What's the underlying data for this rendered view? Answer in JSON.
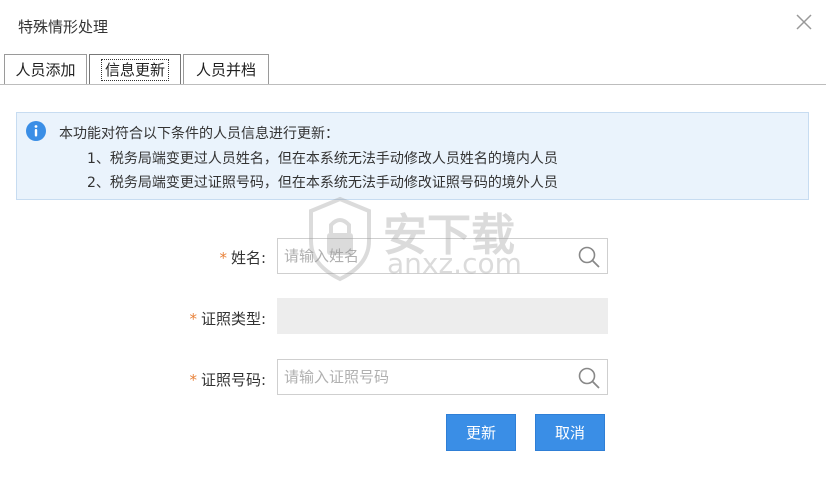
{
  "dialog": {
    "title": "特殊情形处理",
    "close_icon": "close-icon"
  },
  "tabs": [
    {
      "label": "人员添加",
      "active": false
    },
    {
      "label": "信息更新",
      "active": true
    },
    {
      "label": "人员并档",
      "active": false
    }
  ],
  "notice": {
    "icon": "info-icon",
    "line1": "本功能对符合以下条件的人员信息进行更新：",
    "line2": "1、税务局端变更过人员姓名，但在本系统无法手动修改人员姓名的境内人员",
    "line3": "2、税务局端变更过证照号码，但在本系统无法手动修改证照号码的境外人员"
  },
  "form": {
    "required_mark": "*",
    "name_label": "姓名:",
    "name_placeholder": "请输入姓名",
    "id_type_label": "证照类型:",
    "id_number_label": "证照号码:",
    "id_number_placeholder": "请输入证照号码"
  },
  "buttons": {
    "update": "更新",
    "cancel": "取消"
  },
  "watermark": {
    "text_cn": "安下载",
    "text_en": "anxz.com"
  },
  "colors": {
    "primary_button": "#3a8ee6",
    "notice_bg": "#eaf3fc",
    "required": "#e8823a",
    "info_icon": "#3a8ee6"
  }
}
